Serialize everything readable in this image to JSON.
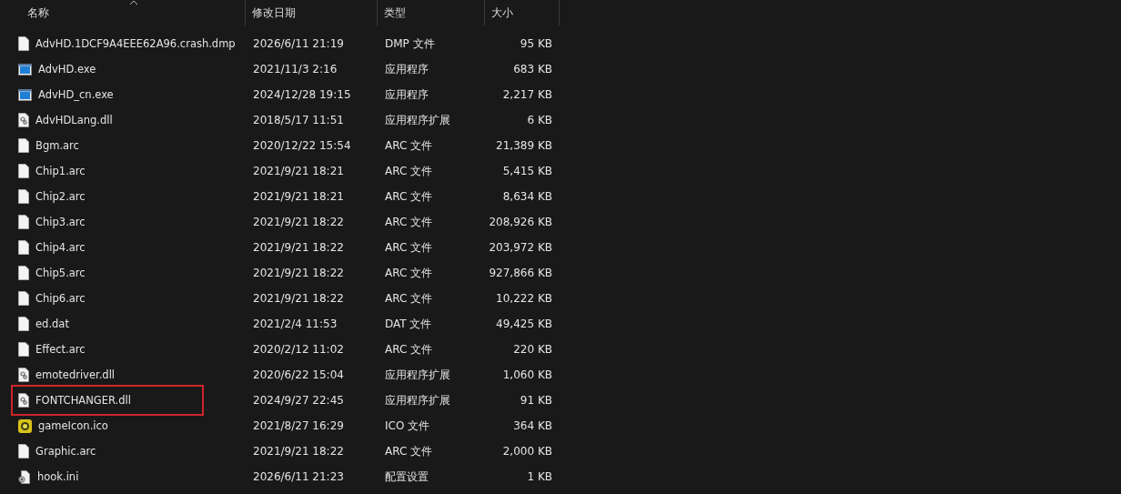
{
  "columns": [
    {
      "label": "名称",
      "sorted": true
    },
    {
      "label": "修改日期",
      "sorted": false
    },
    {
      "label": "类型",
      "sorted": false
    },
    {
      "label": "大小",
      "sorted": false
    }
  ],
  "files": [
    {
      "name": "AdvHD.1DCF9A4EEE62A96.crash.dmp",
      "date": "2026/6/11 21:19",
      "type": "DMP 文件",
      "size": "95 KB",
      "kind": "file",
      "highlighted": false
    },
    {
      "name": "AdvHD.exe",
      "date": "2021/11/3 2:16",
      "type": "应用程序",
      "size": "683 KB",
      "kind": "exe",
      "highlighted": false
    },
    {
      "name": "AdvHD_cn.exe",
      "date": "2024/12/28 19:15",
      "type": "应用程序",
      "size": "2,217 KB",
      "kind": "exe",
      "highlighted": false
    },
    {
      "name": "AdvHDLang.dll",
      "date": "2018/5/17 11:51",
      "type": "应用程序扩展",
      "size": "6 KB",
      "kind": "dll",
      "highlighted": false
    },
    {
      "name": "Bgm.arc",
      "date": "2020/12/22 15:54",
      "type": "ARC 文件",
      "size": "21,389 KB",
      "kind": "file",
      "highlighted": false
    },
    {
      "name": "Chip1.arc",
      "date": "2021/9/21 18:21",
      "type": "ARC 文件",
      "size": "5,415 KB",
      "kind": "file",
      "highlighted": false
    },
    {
      "name": "Chip2.arc",
      "date": "2021/9/21 18:21",
      "type": "ARC 文件",
      "size": "8,634 KB",
      "kind": "file",
      "highlighted": false
    },
    {
      "name": "Chip3.arc",
      "date": "2021/9/21 18:22",
      "type": "ARC 文件",
      "size": "208,926 KB",
      "kind": "file",
      "highlighted": false
    },
    {
      "name": "Chip4.arc",
      "date": "2021/9/21 18:22",
      "type": "ARC 文件",
      "size": "203,972 KB",
      "kind": "file",
      "highlighted": false
    },
    {
      "name": "Chip5.arc",
      "date": "2021/9/21 18:22",
      "type": "ARC 文件",
      "size": "927,866 KB",
      "kind": "file",
      "highlighted": false
    },
    {
      "name": "Chip6.arc",
      "date": "2021/9/21 18:22",
      "type": "ARC 文件",
      "size": "10,222 KB",
      "kind": "file",
      "highlighted": false
    },
    {
      "name": "ed.dat",
      "date": "2021/2/4 11:53",
      "type": "DAT 文件",
      "size": "49,425 KB",
      "kind": "file",
      "highlighted": false
    },
    {
      "name": "Effect.arc",
      "date": "2020/2/12 11:02",
      "type": "ARC 文件",
      "size": "220 KB",
      "kind": "file",
      "highlighted": false
    },
    {
      "name": "emotedriver.dll",
      "date": "2020/6/22 15:04",
      "type": "应用程序扩展",
      "size": "1,060 KB",
      "kind": "dll",
      "highlighted": false
    },
    {
      "name": "FONTCHANGER.dll",
      "date": "2024/9/27 22:45",
      "type": "应用程序扩展",
      "size": "91 KB",
      "kind": "dll",
      "highlighted": true
    },
    {
      "name": "gameIcon.ico",
      "date": "2021/8/27 16:29",
      "type": "ICO 文件",
      "size": "364 KB",
      "kind": "ico",
      "highlighted": false
    },
    {
      "name": "Graphic.arc",
      "date": "2021/9/21 18:22",
      "type": "ARC 文件",
      "size": "2,000 KB",
      "kind": "file",
      "highlighted": false
    },
    {
      "name": "hook.ini",
      "date": "2026/6/11 21:23",
      "type": "配置设置",
      "size": "1 KB",
      "kind": "ini",
      "highlighted": false
    }
  ]
}
